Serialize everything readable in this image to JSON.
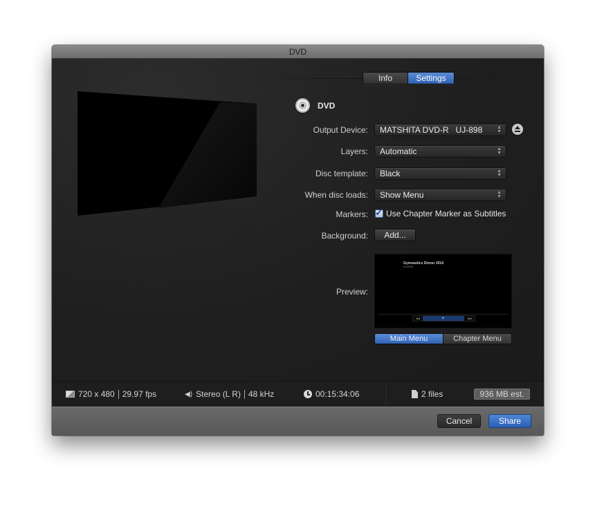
{
  "window": {
    "title": "DVD"
  },
  "tabs": [
    {
      "label": "Info",
      "active": false
    },
    {
      "label": "Settings",
      "active": true
    }
  ],
  "format": {
    "icon": "dvd-disc-icon",
    "label": "DVD"
  },
  "form": {
    "output_device": {
      "label": "Output Device:",
      "value": "MATSHITA DVD-R   UJ-898",
      "eject_icon": "eject-icon"
    },
    "layers": {
      "label": "Layers:",
      "value": "Automatic"
    },
    "disc_template": {
      "label": "Disc template:",
      "value": "Black"
    },
    "when_disc_loads": {
      "label": "When disc loads:",
      "value": "Show Menu"
    },
    "markers": {
      "label": "Markers:",
      "checkbox_label": "Use Chapter Marker as Subtitles",
      "checked": true
    },
    "background": {
      "label": "Background:",
      "button": "Add..."
    },
    "preview": {
      "label": "Preview:",
      "menu_title": "Gymnastics Dinner 2014",
      "menu_subtitle": "01:20:00",
      "controls": {
        "prev": "◀◀",
        "play": "▶",
        "next": "▶▶"
      },
      "menu_tabs": [
        {
          "label": "Main Menu",
          "active": true
        },
        {
          "label": "Chapter Menu",
          "active": false
        }
      ]
    }
  },
  "status": {
    "resolution": "720 x 480",
    "fps": "29.97 fps",
    "audio_channels": "Stereo (L R)",
    "audio_rate": "48 kHz",
    "duration": "00:15:34:06",
    "files": "2 files",
    "size_estimate": "936 MB est."
  },
  "footer": {
    "cancel": "Cancel",
    "share": "Share"
  },
  "colors": {
    "accent": "#3a6fc4",
    "background": "#222222",
    "footer": "#626262"
  }
}
